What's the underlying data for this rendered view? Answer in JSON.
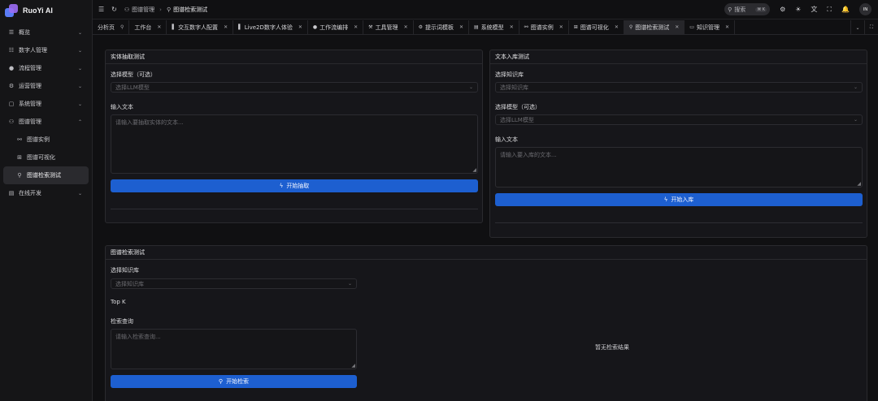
{
  "app": {
    "name": "RuoYi AI"
  },
  "sidebar": {
    "items": [
      {
        "label": "概览",
        "icon": "overview-icon",
        "glyph": "☰"
      },
      {
        "label": "数字人管理",
        "icon": "digital-human-icon",
        "glyph": "👥"
      },
      {
        "label": "流程管理",
        "icon": "flow-icon",
        "glyph": "👤"
      },
      {
        "label": "运营管理",
        "icon": "operation-icon",
        "glyph": "⚙"
      },
      {
        "label": "系统管理",
        "icon": "system-icon",
        "glyph": "▢"
      },
      {
        "label": "图谱管理",
        "icon": "graph-icon",
        "glyph": "⚇"
      },
      {
        "label": "图谱实例",
        "icon": "graph-instance-icon",
        "glyph": "⚯"
      },
      {
        "label": "图谱可视化",
        "icon": "graph-visual-icon",
        "glyph": "⊞"
      },
      {
        "label": "图谱检索测试",
        "icon": "graph-search-icon",
        "glyph": "⚲"
      },
      {
        "label": "在线开发",
        "icon": "dev-icon",
        "glyph": "▤"
      }
    ]
  },
  "topbar": {
    "breadcrumb": [
      "图谱管理",
      "图谱检索测试"
    ],
    "search_label": "搜索",
    "search_kbd": "⌘ K",
    "avatar": "IN"
  },
  "tabs": [
    {
      "label": "分析页",
      "icon": "",
      "closable": false,
      "pin": true
    },
    {
      "label": "工作台",
      "icon": "",
      "closable": true
    },
    {
      "label": "交互数字人配置",
      "icon": "▌",
      "closable": true
    },
    {
      "label": "Live2D数字人体验",
      "icon": "▌",
      "closable": true
    },
    {
      "label": "工作流编排",
      "icon": "👤",
      "closable": true
    },
    {
      "label": "工具管理",
      "icon": "🔧",
      "closable": true
    },
    {
      "label": "提示词模板",
      "icon": "⚙",
      "closable": true
    },
    {
      "label": "系统模型",
      "icon": "▤",
      "closable": true
    },
    {
      "label": "图谱实例",
      "icon": "⚯",
      "closable": true
    },
    {
      "label": "图谱可视化",
      "icon": "⊞",
      "closable": true
    },
    {
      "label": "图谱检索测试",
      "icon": "⚲",
      "closable": true,
      "active": true
    },
    {
      "label": "知识管理",
      "icon": "▭",
      "closable": true
    }
  ],
  "entity_card": {
    "title": "实体抽取测试",
    "model_label": "选择模型（可选）",
    "model_placeholder": "选择LLM模型",
    "text_label": "输入文本",
    "text_placeholder": "请输入要抽取实体的文本...",
    "button": "开始抽取"
  },
  "ingest_card": {
    "title": "文本入库测试",
    "kb_label": "选择知识库",
    "kb_placeholder": "选择知识库",
    "model_label": "选择模型（可选）",
    "model_placeholder": "选择LLM模型",
    "text_label": "输入文本",
    "text_placeholder": "请输入要入库的文本...",
    "button": "开始入库"
  },
  "search_card": {
    "title": "图谱检索测试",
    "kb_label": "选择知识库",
    "kb_placeholder": "选择知识库",
    "topk_label": "Top K",
    "query_label": "检索查询",
    "query_placeholder": "请输入检索查询...",
    "button": "开始检索",
    "empty_text": "暂无检索结果"
  },
  "colors": {
    "accent": "#1d5fd0",
    "background": "#101012",
    "card": "#16161a"
  }
}
